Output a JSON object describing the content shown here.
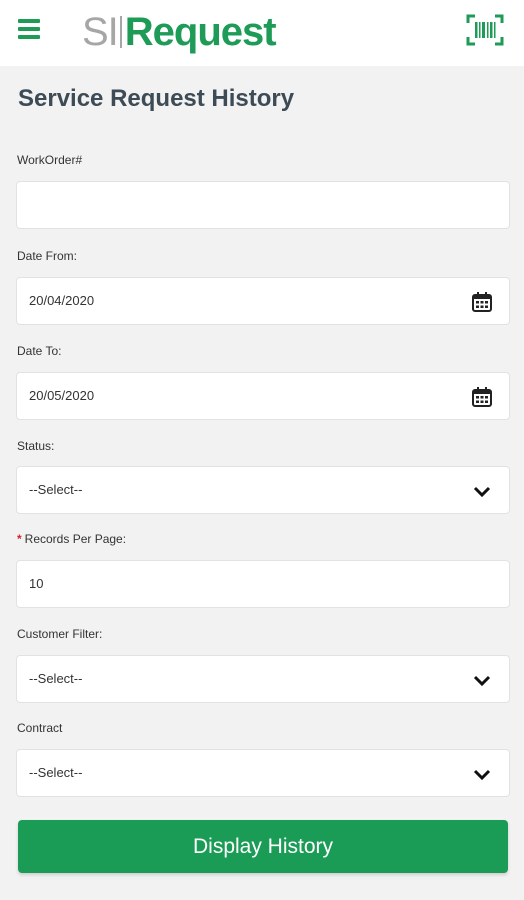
{
  "header": {
    "logo_si": "SI",
    "logo_request": "Request",
    "menu_icon": "hamburger-menu-icon",
    "scan_icon": "barcode-scan-icon",
    "accent_color": "#1e9b57"
  },
  "page": {
    "title": "Service Request History"
  },
  "form": {
    "workorder": {
      "label": "WorkOrder#",
      "value": ""
    },
    "date_from": {
      "label": "Date From:",
      "value": "20/04/2020",
      "icon": "calendar-icon"
    },
    "date_to": {
      "label": "Date To:",
      "value": "20/05/2020",
      "icon": "calendar-icon"
    },
    "status": {
      "label": "Status:",
      "value": "--Select--",
      "icon": "chevron-down-icon"
    },
    "records_per_page": {
      "required_mark": "*",
      "label": "Records Per Page:",
      "value": "10"
    },
    "customer_filter": {
      "label": "Customer Filter:",
      "value": "--Select--",
      "icon": "chevron-down-icon"
    },
    "contract": {
      "label": "Contract",
      "value": "--Select--",
      "icon": "chevron-down-icon"
    }
  },
  "actions": {
    "display_history": "Display History",
    "button_color": "#1a9c57"
  }
}
